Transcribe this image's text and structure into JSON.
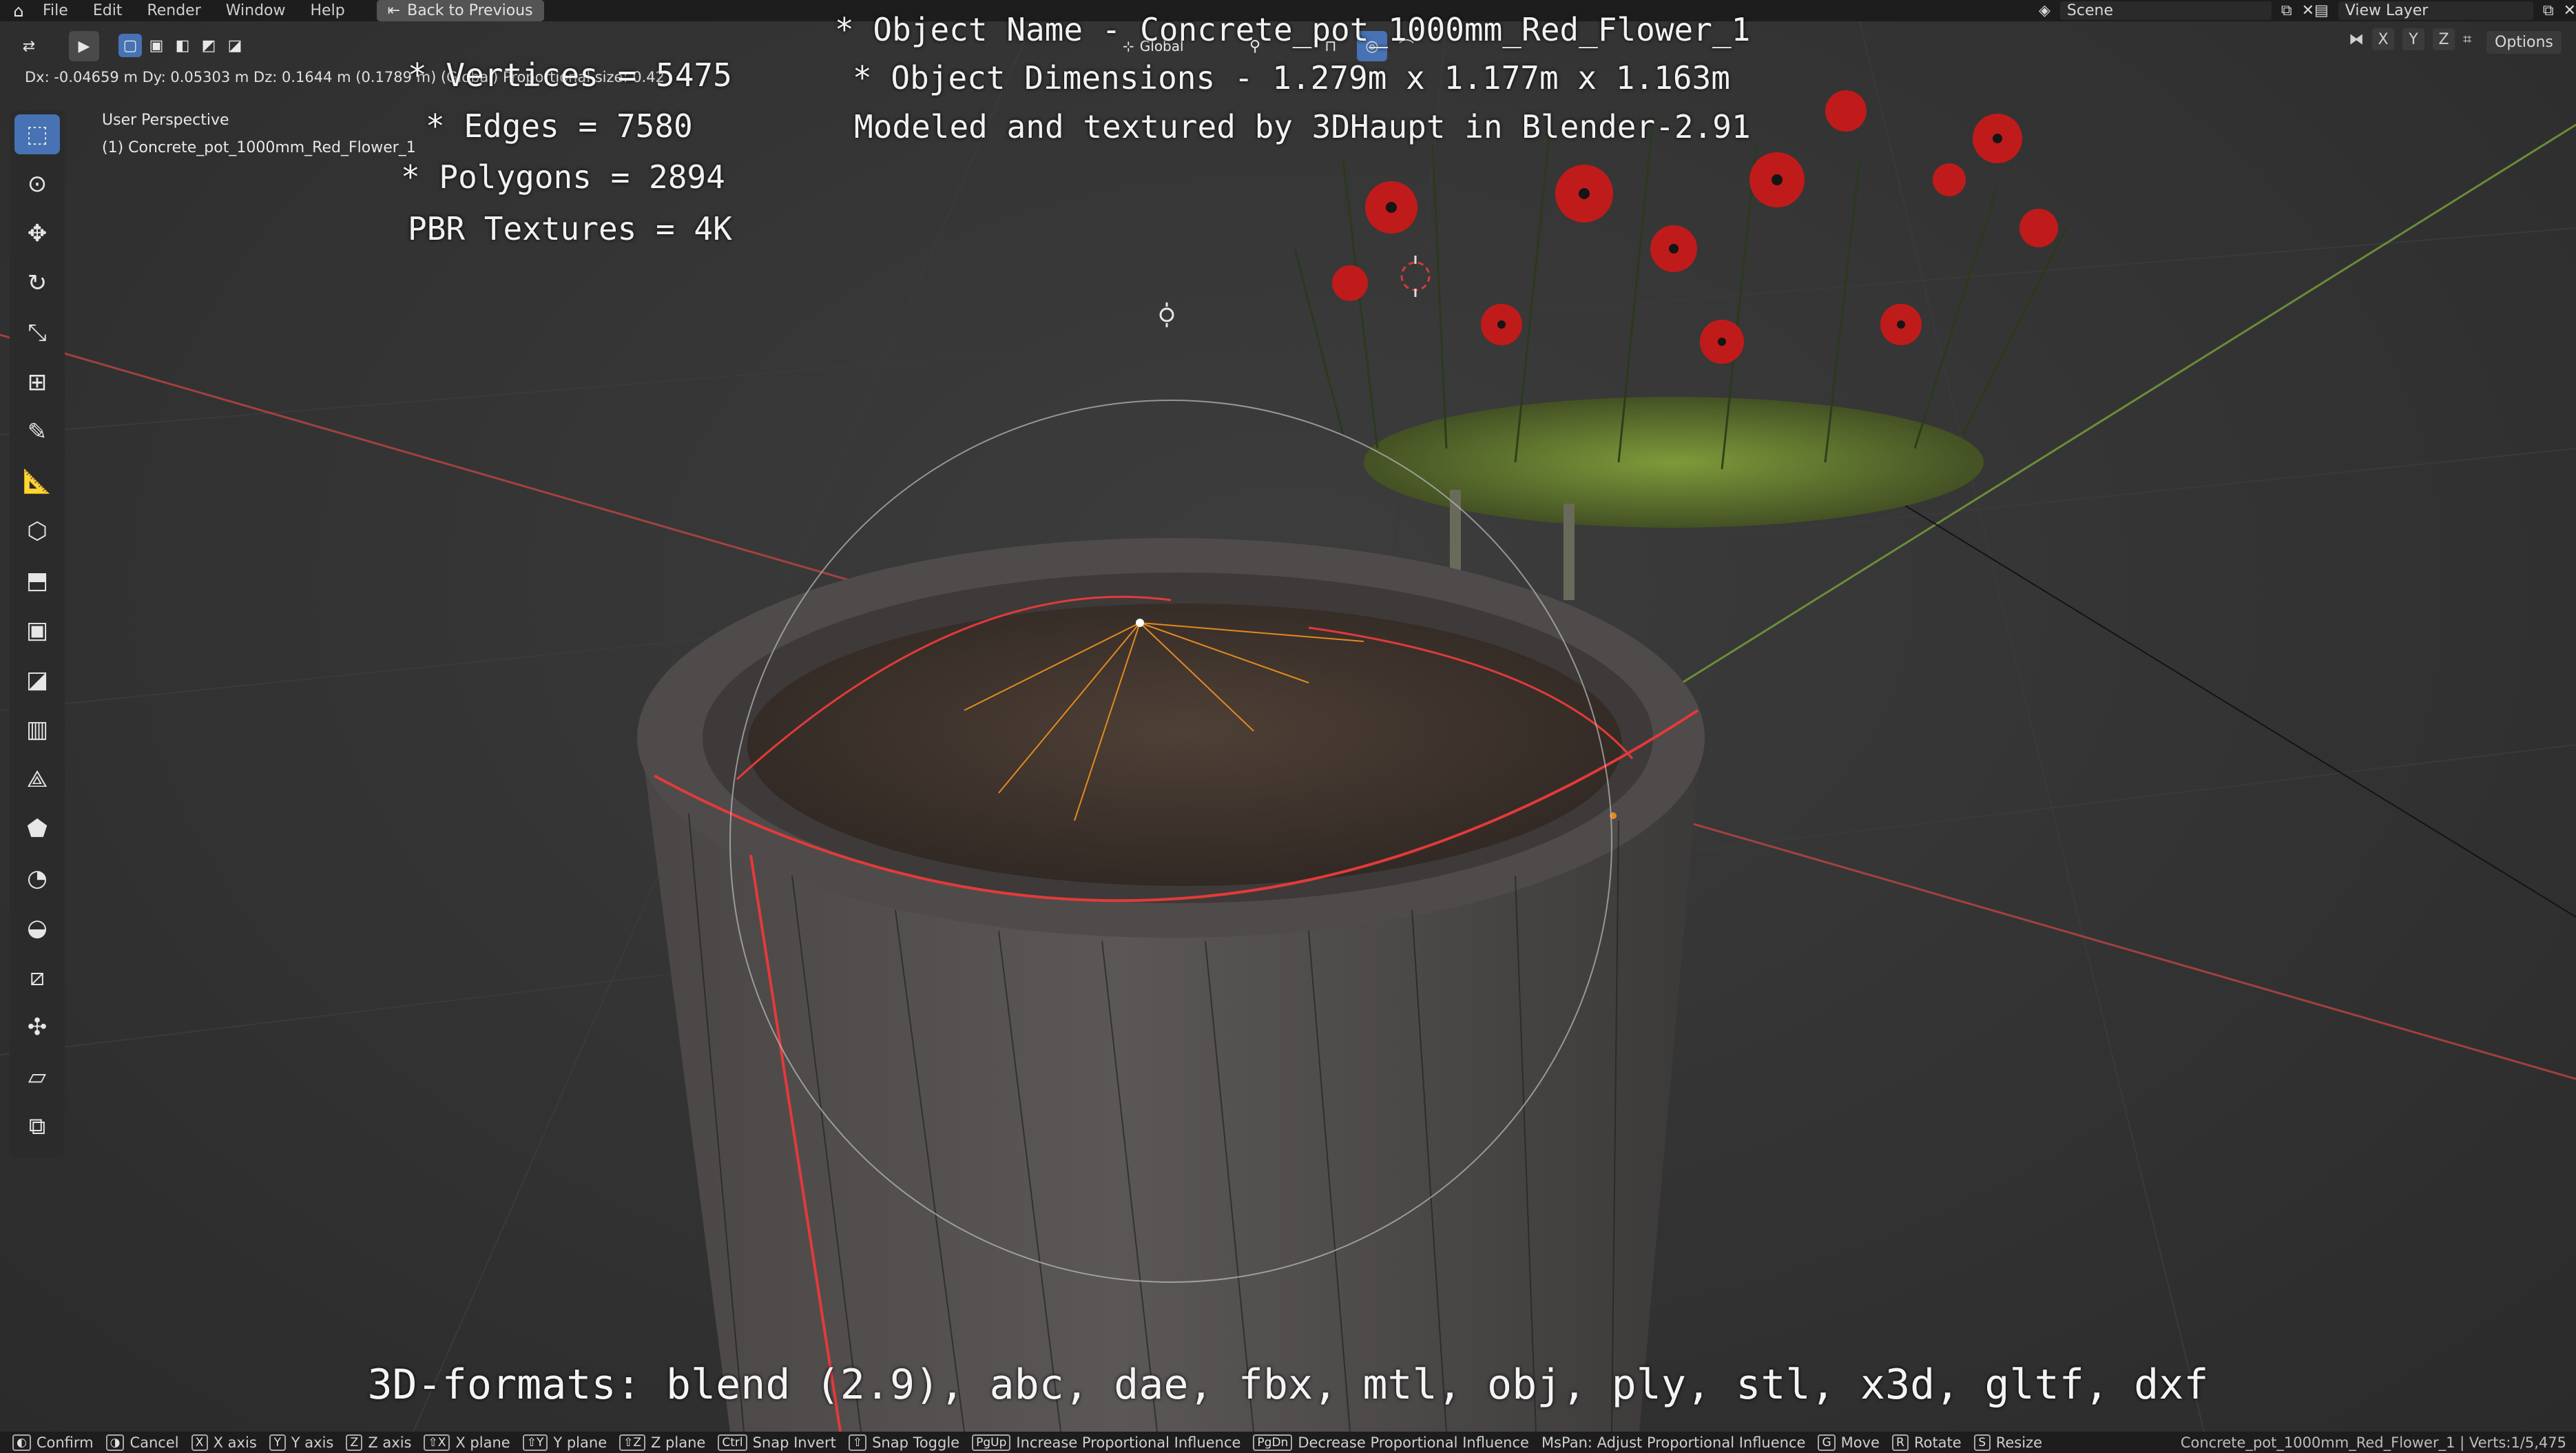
{
  "menubar": {
    "items": [
      "File",
      "Edit",
      "Render",
      "Window",
      "Help"
    ],
    "back_button": "Back to Previous",
    "scene_label": "Scene",
    "view_layer_label": "View Layer"
  },
  "viewport_header": {
    "orientation_label": "Global",
    "options_label": "Options",
    "axis_toggles": [
      "X",
      "Y",
      "Z"
    ]
  },
  "readout": "Dx: -0.04659 m  Dy: 0.05303 m  Dz: 0.1644 m (0.1789 m) (Global)  Proportional size: 0.42",
  "view": {
    "perspective": "User Perspective",
    "object": "(1) Concrete_pot_1000mm_Red_Flower_1"
  },
  "stats": {
    "vertices": "* Vertices = 5475",
    "edges": "* Edges = 7580",
    "polygons": "* Polygons = 2894",
    "textures": "PBR Textures = 4K"
  },
  "info": {
    "name": "* Object Name - Concrete_pot_1000mm_Red_Flower_1",
    "dimensions": "* Object Dimensions -  1.279m x 1.177m x 1.163m",
    "credit": "Modeled and textured by 3DHaupt in Blender-2.91"
  },
  "formats": "3D-formats: blend (2.9), abc, dae, fbx, mtl, obj, ply, stl, x3d, gltf, dxf",
  "toolbar": {
    "tools": [
      "select-box",
      "cursor",
      "move",
      "rotate",
      "scale",
      "transform",
      "annotate",
      "measure",
      "add-cube",
      "extrude",
      "inset",
      "bevel",
      "loop-cut",
      "knife",
      "poly-build",
      "spin",
      "smooth",
      "edge-slide",
      "shrink-fatten",
      "shear",
      "rip-region"
    ]
  },
  "statusbar": {
    "items": [
      {
        "key": "",
        "label": "Confirm"
      },
      {
        "key": "",
        "label": "Cancel"
      },
      {
        "key": "X",
        "label": "X axis"
      },
      {
        "key": "Y",
        "label": "Y axis"
      },
      {
        "key": "Z",
        "label": "Z axis"
      },
      {
        "key": "⇧X",
        "label": "X plane"
      },
      {
        "key": "⇧Y",
        "label": "Y plane"
      },
      {
        "key": "⇧Z",
        "label": "Z plane"
      },
      {
        "key": "Ctrl",
        "label": "Snap Invert"
      },
      {
        "key": "⇧",
        "label": "Snap Toggle"
      },
      {
        "key": "PgUp",
        "label": "Increase Proportional Influence"
      },
      {
        "key": "PgDn",
        "label": "Decrease Proportional Influence"
      },
      {
        "key": "",
        "label": "MsPan: Adjust Proportional Influence"
      },
      {
        "key": "G",
        "label": "Move"
      },
      {
        "key": "R",
        "label": "Rotate"
      },
      {
        "key": "S",
        "label": "Resize"
      }
    ],
    "right_text": "Concrete_pot_1000mm_Red_Flower_1 | Verts:1/5,475"
  },
  "colors": {
    "x_axis": "#c94545",
    "y_axis": "#7aa33a",
    "accent": "#4772b3",
    "flower": "#c01b1b"
  }
}
